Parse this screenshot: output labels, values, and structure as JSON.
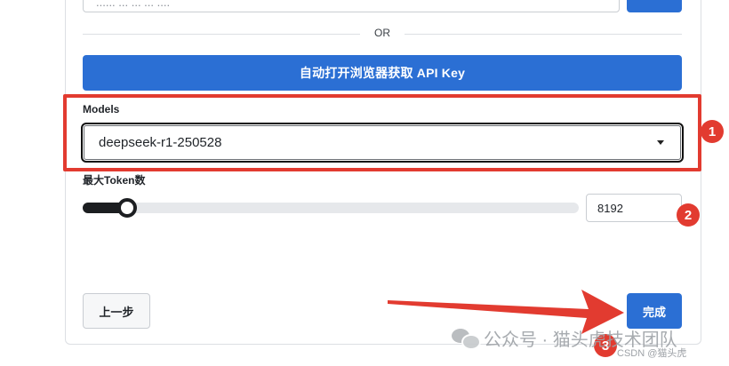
{
  "top": {
    "input_value": "...... ... ... ... ...."
  },
  "divider": {
    "or_label": "OR"
  },
  "api_button_label": "自动打开浏览器获取 API Key",
  "models": {
    "label": "Models",
    "selected": "deepseek-r1-250528"
  },
  "tokens": {
    "label": "最大Token数",
    "value": "8192",
    "slider_fraction": 0.09
  },
  "footer": {
    "prev_label": "上一步",
    "done_label": "完成"
  },
  "annotations": {
    "badge1": "1",
    "badge2": "2",
    "badge3": "3",
    "highlight_color": "#e23b30"
  },
  "watermark": {
    "text": "公众号 · 猫头虎技术团队",
    "csdn": "CSDN @猫头虎"
  },
  "colors": {
    "accent": "#2b6fd4",
    "annotation_red": "#e23b30"
  }
}
